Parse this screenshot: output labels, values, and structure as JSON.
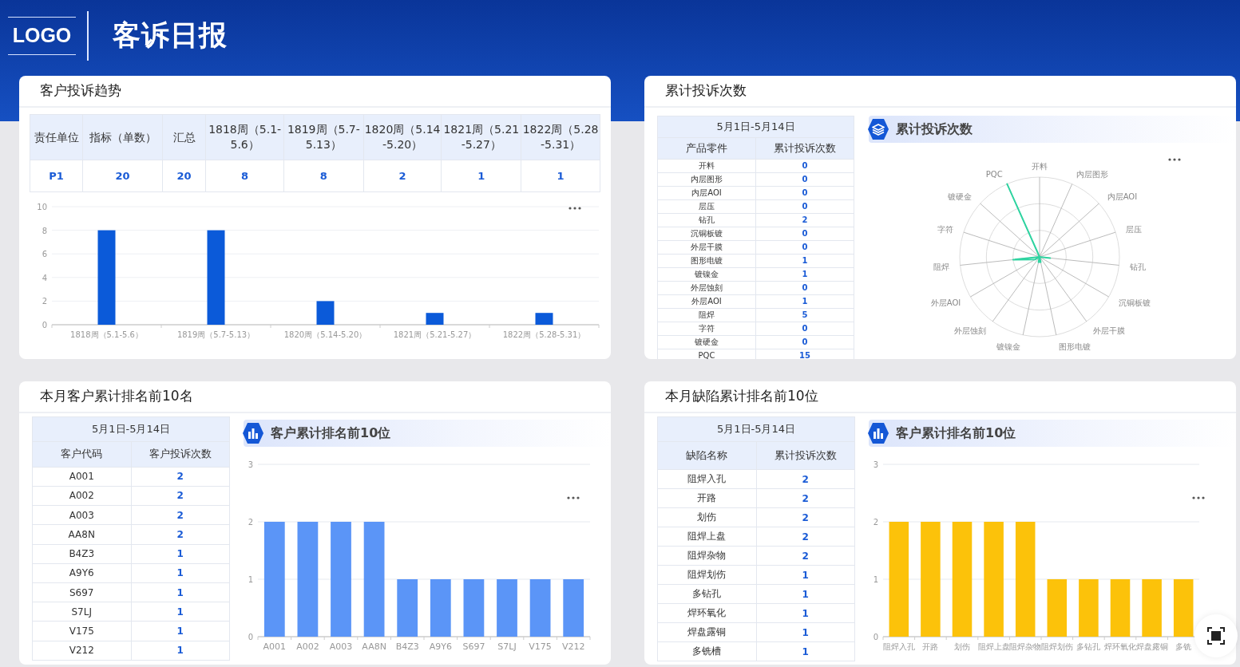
{
  "header": {
    "logo": "LOGO",
    "title": "客诉日报"
  },
  "trend": {
    "title": "客户投诉趋势",
    "table": {
      "columns": [
        "责任单位",
        "指标（单数）",
        "汇总",
        "1818周（5.1-5.6）",
        "1819周（5.7-5.13）",
        "1820周（5.14-5.20）",
        "1821周（5.21-5.27）",
        "1822周（5.28-5.31）"
      ],
      "rows": [
        [
          "P1",
          "20",
          "20",
          "8",
          "8",
          "2",
          "1",
          "1"
        ]
      ]
    },
    "chart_data": {
      "type": "bar",
      "categories": [
        "1818周（5.1-5.6）",
        "1819周（5.7-5.13）",
        "1820周（5.14-5.20）",
        "1821周（5.21-5.27）",
        "1822周（5.28-5.31）"
      ],
      "series": [
        {
          "color": "#0b5ad9",
          "values": [
            8,
            8,
            2,
            1,
            1
          ]
        }
      ],
      "ylim": [
        0,
        10
      ],
      "yticks": [
        0,
        2,
        4,
        6,
        8,
        10
      ],
      "grid": true
    }
  },
  "cumulative": {
    "title": "累计投诉次数",
    "table": {
      "period": "5月1日-5月14日",
      "columns": [
        "产品零件",
        "累计投诉次数"
      ],
      "rows": [
        {
          "name": "开料",
          "count": "0"
        },
        {
          "name": "内层图形",
          "count": "0"
        },
        {
          "name": "内层AOI",
          "count": "0"
        },
        {
          "name": "层压",
          "count": "0"
        },
        {
          "name": "钻孔",
          "count": "2"
        },
        {
          "name": "沉铜板镀",
          "count": "0"
        },
        {
          "name": "外层干膜",
          "count": "0"
        },
        {
          "name": "图形电镀",
          "count": "1"
        },
        {
          "name": "镀镍金",
          "count": "1"
        },
        {
          "name": "外层蚀刻",
          "count": "0"
        },
        {
          "name": "外层AOI",
          "count": "1"
        },
        {
          "name": "阻焊",
          "count": "5"
        },
        {
          "name": "字符",
          "count": "0"
        },
        {
          "name": "镀硬金",
          "count": "0"
        },
        {
          "name": "PQC",
          "count": "15"
        }
      ]
    },
    "radar": {
      "title": "累计投诉次数",
      "right_axes": [
        "开料",
        "内层图形",
        "内层AOI",
        "层压",
        "钻孔",
        "沉铜板镀",
        "外层干膜",
        "图形电镀"
      ],
      "left_axes": [
        "PQC",
        "镀硬金",
        "字符",
        "阻焊",
        "外层AOI",
        "外层蚀刻",
        "镀镍金"
      ]
    }
  },
  "rankings": [
    {
      "title": "本月客户累计排名前10名",
      "table": {
        "period": "5月1日-5月14日",
        "columns": [
          "客户代码",
          "客户投诉次数"
        ],
        "rows": [
          {
            "name": "A001",
            "count": "2"
          },
          {
            "name": "A002",
            "count": "2"
          },
          {
            "name": "A003",
            "count": "2"
          },
          {
            "name": "AA8N",
            "count": "2"
          },
          {
            "name": "B4Z3",
            "count": "1"
          },
          {
            "name": "A9Y6",
            "count": "1"
          },
          {
            "name": "S697",
            "count": "1"
          },
          {
            "name": "S7LJ",
            "count": "1"
          },
          {
            "name": "V175",
            "count": "1"
          },
          {
            "name": "V212",
            "count": "1"
          }
        ]
      },
      "chart_title": "客户累计排名前10位",
      "chart_data": {
        "type": "bar",
        "categories": [
          "A001",
          "A002",
          "A003",
          "AA8N",
          "B4Z3",
          "A9Y6",
          "S697",
          "S7LJ",
          "V175",
          "V212"
        ],
        "series": [
          {
            "color": "#5b95f7",
            "values": [
              2,
              2,
              2,
              2,
              1,
              1,
              1,
              1,
              1,
              1
            ]
          }
        ],
        "ylim": [
          0,
          3
        ],
        "yticks": [
          0,
          1,
          2,
          3
        ],
        "grid": true
      }
    },
    {
      "title": "本月缺陷累计排名前10位",
      "table": {
        "period": "5月1日-5月14日",
        "columns": [
          "缺陷名称",
          "累计投诉次数"
        ],
        "rows": [
          {
            "name": "阻焊入孔",
            "count": "2"
          },
          {
            "name": "开路",
            "count": "2"
          },
          {
            "name": "划伤",
            "count": "2"
          },
          {
            "name": "阻焊上盘",
            "count": "2"
          },
          {
            "name": "阻焊杂物",
            "count": "2"
          },
          {
            "name": "阻焊划伤",
            "count": "1"
          },
          {
            "name": "多钻孔",
            "count": "1"
          },
          {
            "name": "焊环氧化",
            "count": "1"
          },
          {
            "name": "焊盘露铜",
            "count": "1"
          },
          {
            "name": "多铣槽",
            "count": "1"
          }
        ]
      },
      "chart_title": "客户累计排名前10位",
      "chart_data": {
        "type": "bar",
        "categories": [
          "阻焊入孔",
          "开路",
          "划伤",
          "阻焊上盘",
          "阻焊杂物",
          "阻焊划伤",
          "多钻孔",
          "焊环氧化",
          "焊盘露铜",
          "多铣"
        ],
        "series": [
          {
            "color": "#fcc20a",
            "values": [
              2,
              2,
              2,
              2,
              2,
              1,
              1,
              1,
              1,
              1
            ]
          }
        ],
        "ylim": [
          0,
          3
        ],
        "yticks": [
          0,
          1,
          2,
          3
        ],
        "grid": true
      }
    }
  ]
}
